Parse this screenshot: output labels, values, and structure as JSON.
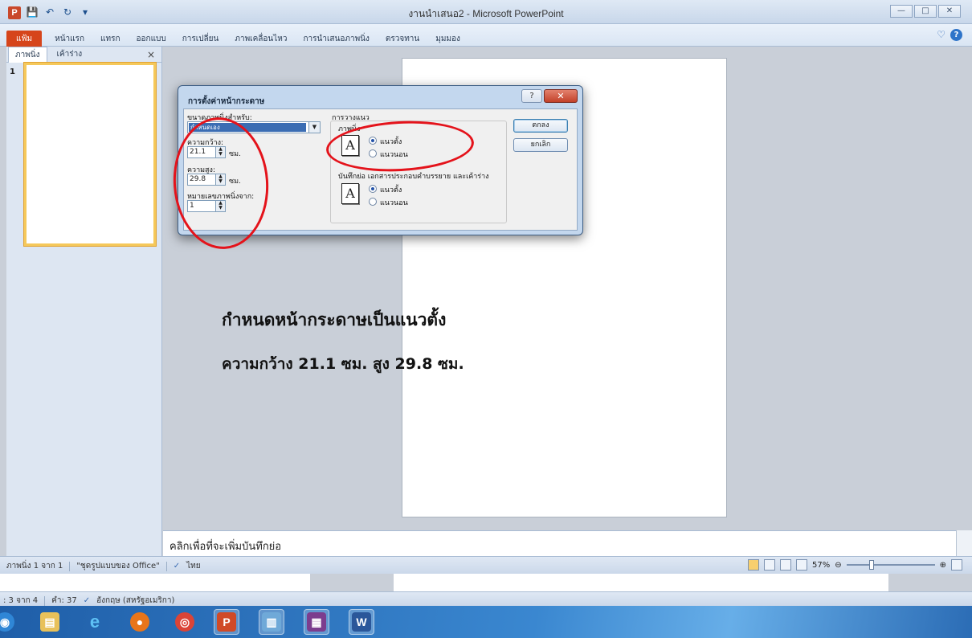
{
  "window": {
    "title": "งานนำเสนอ2 - Microsoft PowerPoint",
    "app_icon": "P",
    "controls": [
      "—",
      "□",
      "✕"
    ]
  },
  "ribbon": {
    "tabs": [
      "แฟ้ม",
      "หน้าแรก",
      "แทรก",
      "ออกแบบ",
      "การเปลี่ยน",
      "ภาพเคลื่อนไหว",
      "การนำเสนอภาพนิ่ง",
      "ตรวจทาน",
      "มุมมอง"
    ]
  },
  "left_panel": {
    "tabs": [
      "ภาพนิ่ง",
      "เค้าร่าง"
    ],
    "close": "×",
    "slide_number": "1"
  },
  "slide": {
    "line1": "กำหนดหน้ากระดาษเป็นแนวตั้ง",
    "line2": "ความกว้าง 21.1 ซม.  สูง 29.8 ซม."
  },
  "notes": {
    "placeholder": "คลิกเพื่อที่จะเพิ่มบันทึกย่อ"
  },
  "statusbar": {
    "slide_info": "ภาพนิ่ง 1 จาก 1",
    "theme": "\"ชุดรูปแบบของ Office\"",
    "language": "ไทย",
    "zoom": "57%"
  },
  "bg_statusbar": {
    "page": ": 3 จาก 4",
    "words": "คำ: 37",
    "language": "อังกฤษ (สหรัฐอเมริกา)"
  },
  "dialog": {
    "title": "การตั้งค่าหน้ากระดาษ",
    "help": "?",
    "close": "✕",
    "size_label": "ขนาดภาพนิ่งสำหรับ:",
    "size_value": "กำหนดเอง",
    "width_label": "ความกว้าง:",
    "width_value": "21.1",
    "height_label": "ความสูง:",
    "height_value": "29.8",
    "unit": "ซม.",
    "numbering_label": "หมายเลขภาพนิ่งจาก:",
    "numbering_value": "1",
    "orientation_title": "การวางแนว",
    "slides_group": "ภาพนิ่ง",
    "notes_group": "บันทึกย่อ เอกสารประกอบคำบรรยาย และเค้าร่าง",
    "portrait": "แนวตั้ง",
    "landscape": "แนวนอน",
    "ok": "ตกลง",
    "cancel": "ยกเลิก"
  },
  "colors": {
    "file_tab": "#d6451b",
    "annotation": "#e4131b",
    "taskbar": "#2b6cb5"
  },
  "taskbar": {
    "items": [
      "start-orb-icon",
      "file-explorer-icon",
      "internet-explorer-icon",
      "firefox-icon",
      "chrome-icon",
      "powerpoint-icon",
      "window-manager-icon",
      "winrar-icon",
      "word-icon"
    ]
  }
}
